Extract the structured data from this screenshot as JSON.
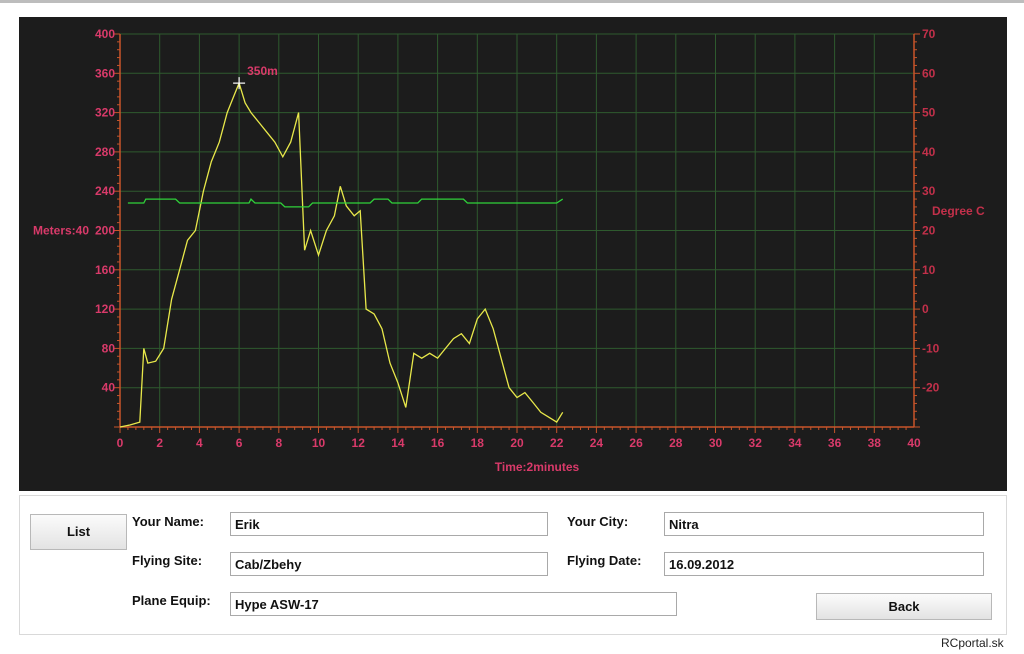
{
  "chart_data": {
    "type": "line",
    "xlabel": "Time:2minutes",
    "ylabel_left": "Meters:40",
    "ylabel_right": "Degree C",
    "x_ticks": [
      "0",
      "2",
      "4",
      "6",
      "8",
      "10",
      "12",
      "14",
      "16",
      "18",
      "20",
      "22",
      "24",
      "26",
      "28",
      "30",
      "32",
      "34",
      "36",
      "38",
      "40"
    ],
    "y_ticks_left": [
      "40",
      "80",
      "120",
      "160",
      "200",
      "240",
      "280",
      "320",
      "360",
      "400"
    ],
    "y_ticks_right": [
      "-20",
      "-10",
      "0",
      "10",
      "20",
      "30",
      "40",
      "50",
      "60",
      "70"
    ],
    "xlim": [
      0,
      40
    ],
    "ylim_left": [
      0,
      400
    ],
    "ylim_right": [
      -30,
      70
    ],
    "grid": true,
    "annotation": {
      "text": "350m",
      "x": 6.0,
      "y": 350
    },
    "series": [
      {
        "axis": "left",
        "color": "#e8e84a",
        "x": [
          0,
          0.5,
          1.0,
          1.2,
          1.4,
          1.8,
          2.2,
          2.6,
          3.0,
          3.4,
          3.8,
          4.2,
          4.6,
          5.0,
          5.4,
          5.7,
          6.0,
          6.3,
          6.6,
          7.0,
          7.4,
          7.8,
          8.2,
          8.6,
          9.0,
          9.3,
          9.6,
          10.0,
          10.4,
          10.8,
          11.1,
          11.4,
          11.8,
          12.1,
          12.4,
          12.8,
          13.2,
          13.6,
          14.0,
          14.4,
          14.8,
          15.2,
          15.6,
          16.0,
          16.4,
          16.8,
          17.2,
          17.6,
          18.0,
          18.4,
          18.8,
          19.2,
          19.6,
          20.0,
          20.4,
          20.8,
          21.2,
          21.6,
          22.0,
          22.3
        ],
        "y": [
          0,
          2,
          5,
          80,
          65,
          67,
          80,
          130,
          160,
          190,
          200,
          240,
          270,
          290,
          320,
          335,
          350,
          330,
          320,
          310,
          300,
          290,
          275,
          290,
          320,
          180,
          200,
          175,
          200,
          215,
          245,
          225,
          215,
          220,
          120,
          115,
          100,
          65,
          45,
          20,
          75,
          70,
          75,
          70,
          80,
          90,
          95,
          85,
          110,
          120,
          100,
          70,
          40,
          30,
          35,
          25,
          15,
          10,
          5,
          15
        ]
      },
      {
        "axis": "right",
        "color": "#2fd13a",
        "x": [
          0.4,
          1.2,
          1.3,
          2.8,
          3.0,
          6.5,
          6.6,
          6.8,
          8.1,
          8.3,
          9.5,
          9.7,
          12.6,
          12.8,
          13.5,
          13.7,
          15.0,
          15.2,
          17.3,
          17.5,
          22.0,
          22.3
        ],
        "y": [
          27,
          27,
          28,
          28,
          27,
          27,
          28,
          27,
          27,
          26,
          26,
          27,
          27,
          28,
          28,
          27,
          27,
          28,
          28,
          27,
          27,
          28
        ]
      }
    ]
  },
  "form": {
    "list_label": "List",
    "your_name_label": "Your Name:",
    "your_name_value": "Erik",
    "your_city_label": "Your City:",
    "your_city_value": "Nitra",
    "flying_site_label": "Flying Site:",
    "flying_site_value": "Cab/Zbehy",
    "flying_date_label": "Flying Date:",
    "flying_date_value": "16.09.2012",
    "plane_equip_label": "Plane Equip:",
    "plane_equip_value": "Hype ASW-17",
    "back_label": "Back"
  },
  "watermark": "RCportal.sk"
}
